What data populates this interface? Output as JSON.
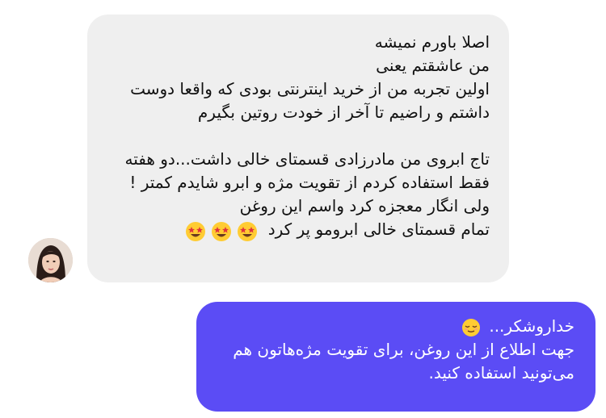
{
  "conversation": {
    "received": {
      "lines": [
        "اصلا باورم نمیشه",
        "من عاشقتم یعنی",
        "اولین تجربه من از خرید اینترنتی بودی که واقعا دوست",
        "داشتم و راضیم تا آخر از خودت روتین بگیرم",
        "",
        "تاج ابروی من مادرزادی قسمتای خالی داشت...دو هفته",
        "فقط استفاده کردم از تقویت مژه و ابرو شایدم کمتر !",
        "ولی انگار معجزه کرد واسم این روغن",
        "تمام قسمتای خالی ابرومو پر کرد"
      ],
      "trailing_emojis": [
        "star-struck-emoji",
        "star-struck-emoji",
        "star-struck-emoji"
      ]
    },
    "sent": {
      "lines": [
        "خداروشکر...",
        "جهت اطلاع از این روغن، برای تقویت مژه‌هاتون هم",
        "می‌تونید استفاده کنید."
      ],
      "trailing_emoji": "relieved-face-emoji"
    }
  },
  "colors": {
    "received_bubble": "#efefef",
    "sent_bubble": "#5b4cf5",
    "text_dark": "#111111",
    "text_light": "#ffffff"
  }
}
